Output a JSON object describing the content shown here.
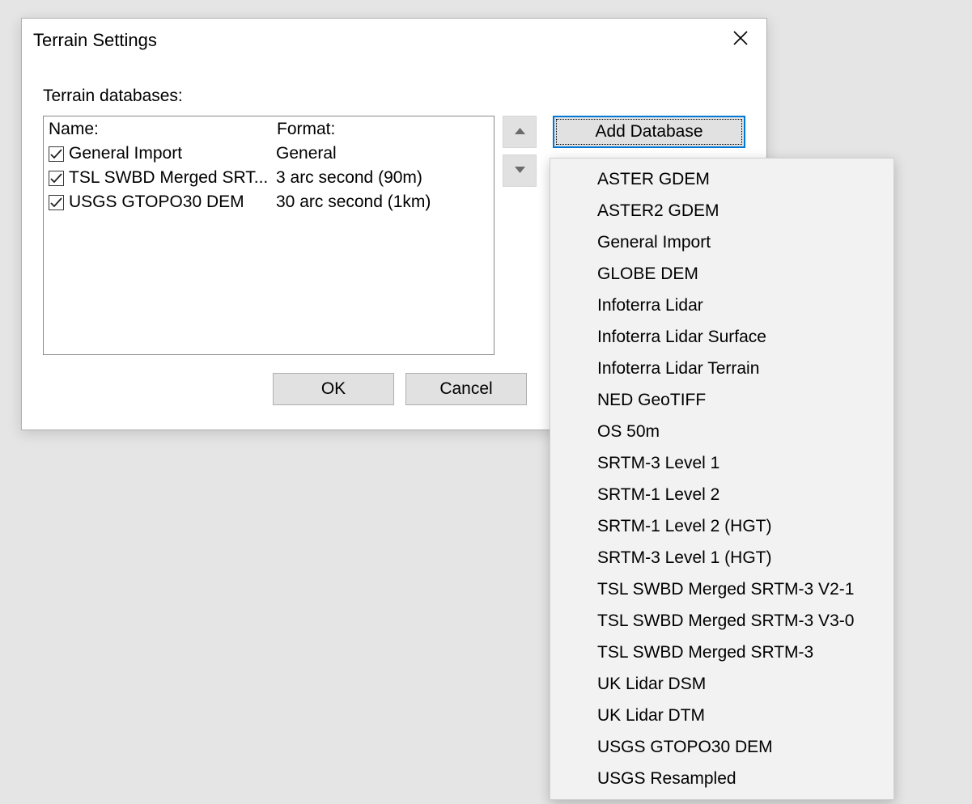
{
  "dialog": {
    "title": "Terrain Settings",
    "section_label": "Terrain databases:",
    "columns": {
      "name": "Name:",
      "format": "Format:"
    },
    "rows": [
      {
        "checked": true,
        "name": "General Import",
        "format": "General"
      },
      {
        "checked": true,
        "name": "TSL SWBD Merged SRT...",
        "format": "3 arc second (90m)"
      },
      {
        "checked": true,
        "name": "USGS GTOPO30 DEM",
        "format": "30 arc second (1km)"
      }
    ],
    "buttons": {
      "add": "Add Database",
      "ok": "OK",
      "cancel": "Cancel"
    }
  },
  "dropdown": {
    "items": [
      "ASTER GDEM",
      "ASTER2 GDEM",
      "General Import",
      "GLOBE DEM",
      "Infoterra Lidar",
      "Infoterra Lidar Surface",
      "Infoterra Lidar Terrain",
      "NED GeoTIFF",
      "OS 50m",
      "SRTM-3 Level 1",
      "SRTM-1 Level 2",
      "SRTM-1 Level 2 (HGT)",
      "SRTM-3 Level 1 (HGT)",
      "TSL SWBD Merged SRTM-3 V2-1",
      "TSL SWBD Merged SRTM-3 V3-0",
      "TSL SWBD Merged SRTM-3",
      "UK Lidar DSM",
      "UK Lidar DTM",
      "USGS GTOPO30 DEM",
      "USGS Resampled"
    ]
  }
}
